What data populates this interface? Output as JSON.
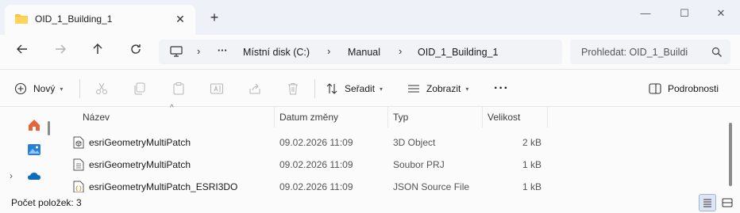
{
  "colors": {
    "accent": "#0067c0",
    "folder": "#f8c44a",
    "chrome_bg": "#eef1f8",
    "surface": "#fbfbfb"
  },
  "tab": {
    "title": "OID_1_Building_1",
    "close_icon": "close-icon",
    "new_tab_icon": "plus-icon"
  },
  "window_controls": {
    "minimize": "—",
    "maximize": "☐",
    "close": "✕"
  },
  "nav": {
    "back_icon": "arrow-left-icon",
    "forward_icon": "arrow-right-icon",
    "up_icon": "arrow-up-icon",
    "refresh_icon": "refresh-icon"
  },
  "address": {
    "computer_icon": "computer-icon",
    "separator": "›",
    "ellipsis": "···",
    "crumbs": [
      "Místní disk (C:)",
      "Manual",
      "OID_1_Building_1"
    ]
  },
  "search": {
    "placeholder": "Prohledat: OID_1_Buildi",
    "icon": "search-icon"
  },
  "toolbar": {
    "new_label": "Nový",
    "sort_label": "Seřadit",
    "view_label": "Zobrazit",
    "more_label": "···",
    "details_label": "Podrobnosti",
    "disabled_icons": [
      "cut-icon",
      "copy-icon",
      "paste-icon",
      "rename-icon",
      "share-icon",
      "delete-icon"
    ]
  },
  "columns": {
    "name": "Název",
    "date": "Datum změny",
    "type": "Typ",
    "size": "Velikost"
  },
  "files": [
    {
      "name": "esriGeometryMultiPatch",
      "date": "09.02.2026 11:09",
      "type": "3D Object",
      "size": "2 kB",
      "icon": "3d-object-icon"
    },
    {
      "name": "esriGeometryMultiPatch",
      "date": "09.02.2026 11:09",
      "type": "Soubor PRJ",
      "size": "1 kB",
      "icon": "text-file-icon"
    },
    {
      "name": "esriGeometryMultiPatch_ESRI3DO",
      "date": "09.02.2026 11:09",
      "type": "JSON Source File",
      "size": "1 kB",
      "icon": "json-file-icon"
    }
  ],
  "sidebar": {
    "items": [
      "home-icon",
      "gallery-icon",
      "onedrive-icon"
    ],
    "expand": "›"
  },
  "status": {
    "item_count": "Počet položek: 3"
  }
}
